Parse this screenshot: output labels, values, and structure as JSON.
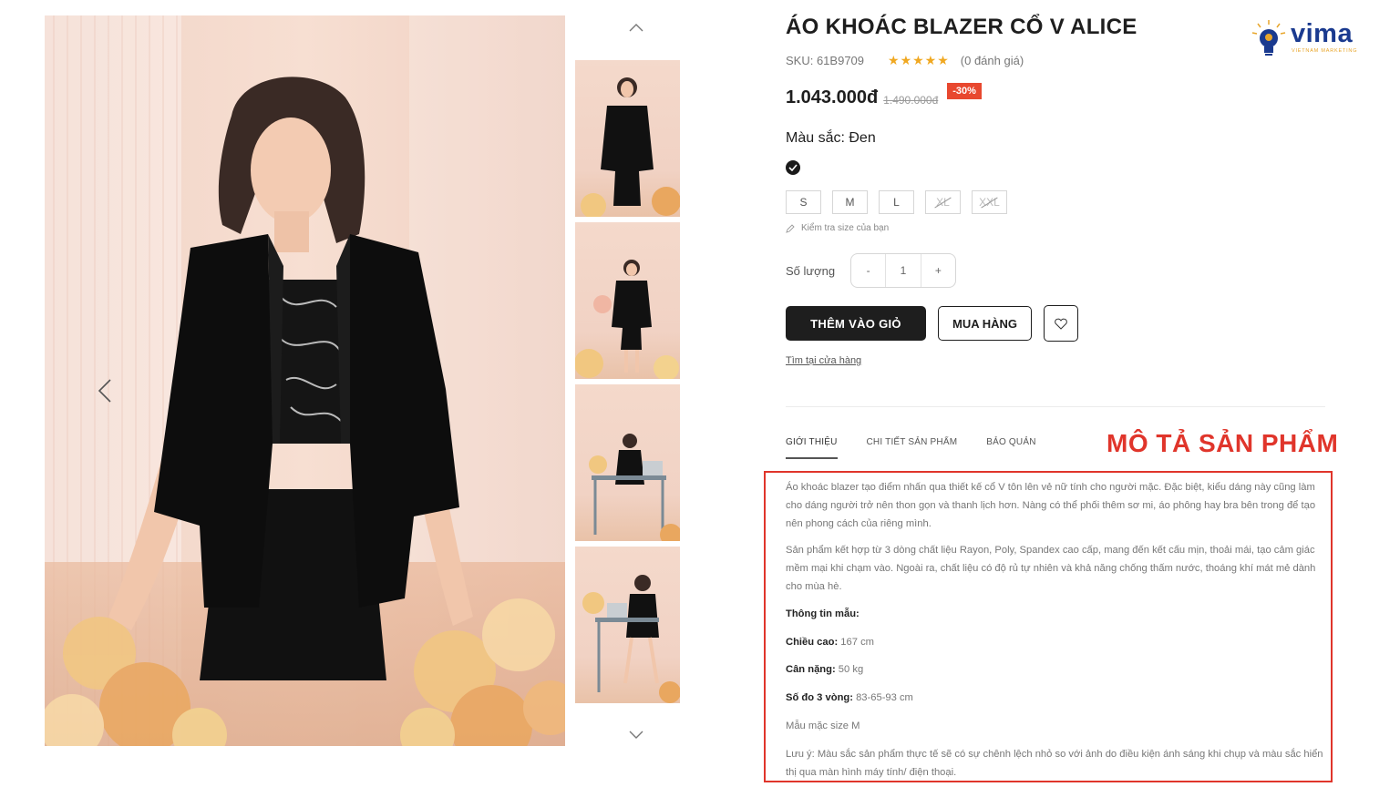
{
  "product": {
    "title": "ÁO KHOÁC BLAZER CỔ V ALICE",
    "sku": "SKU: 61B9709",
    "rating_stars": "★★★★★",
    "reviews": "(0 đánh giá)",
    "price": "1.043.000đ",
    "old_price": "1.490.000đ",
    "discount": "-30%",
    "color_label": "Màu sắc: Đen",
    "selected_color": "#1a1a1a",
    "sizes": [
      {
        "label": "S",
        "available": true
      },
      {
        "label": "M",
        "available": true
      },
      {
        "label": "L",
        "available": true
      },
      {
        "label": "XL",
        "available": false
      },
      {
        "label": "XXL",
        "available": false
      }
    ],
    "size_guide": "Kiểm tra size của bạn",
    "qty_label": "Số lượng",
    "qty_minus": "-",
    "qty_value": "1",
    "qty_plus": "+",
    "add_to_cart": "THÊM VÀO GIỎ",
    "buy_now": "MUA HÀNG",
    "find_store": "Tìm tại cửa hàng"
  },
  "tabs": [
    "GIỚI THIỆU",
    "CHI TIẾT SẢN PHẨM",
    "BẢO QUẢN"
  ],
  "annotation": "MÔ TẢ SẢN PHẨM",
  "description": {
    "para1": "Áo khoác blazer tạo điểm nhấn qua thiết kế cổ V tôn lên vẻ nữ tính cho người mặc. Đặc biệt, kiểu dáng này cũng làm cho dáng người trở nên thon gọn và thanh lịch hơn. Nàng có thể phối thêm sơ mi, áo phông hay bra bên trong để tạo nên phong cách của riêng mình.",
    "para2": "Sản phẩm kết hợp từ 3 dòng chất liệu Rayon, Poly, Spandex cao cấp, mang đến kết cấu mịn, thoải mái, tạo cảm  giác mềm mại khi chạm vào. Ngoài ra, chất liệu có độ rủ tự nhiên và  khả năng chống thấm nước, thoáng khí mát mẻ dành cho mùa hè.",
    "model_info_title": "Thông tin mẫu:",
    "height_label": "Chiều cao:",
    "height_value": " 167 cm",
    "weight_label": "Cân nặng:",
    "weight_value": " 50 kg",
    "measure_label": "Số đo 3 vòng:",
    "measure_value": " 83-65-93 cm",
    "model_size": "Mẫu mặc size M",
    "note": "Lưu ý: Màu sắc sản phẩm thực tế sẽ có sự chênh lệch nhỏ so với ảnh do điều kiện ánh sáng khi chụp và màu sắc hiển thị qua màn hình máy tính/ điện thoại."
  },
  "logo": {
    "text": "vima",
    "sub": "VIETNAM MARKETING",
    "color": "#1a3a8f",
    "accent": "#e8a52a"
  },
  "colors": {
    "accent_red": "#e0352b",
    "discount_bg": "#e8482f",
    "star": "#f0a821"
  },
  "icons": [
    "chevron-left-icon",
    "chevron-right-icon",
    "chevron-up-icon",
    "chevron-down-icon",
    "check-icon",
    "pencil-icon",
    "heart-icon"
  ]
}
